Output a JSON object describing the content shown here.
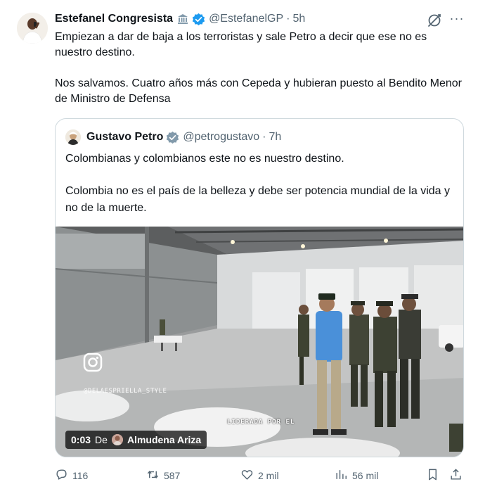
{
  "tweet": {
    "author_name": "Estefanel Congresista",
    "handle": "@EstefanelGP",
    "separator": "·",
    "time": "5h",
    "text_p1": "Empiezan a dar de baja a los terroristas y sale Petro a decir que ese no es nuestro destino.",
    "text_p2": "Nos salvamos. Cuatro años más con Cepeda y hubieran puesto al Bendito Menor de Ministro de Defensa",
    "more_label": "···"
  },
  "quote": {
    "author_name": "Gustavo Petro",
    "handle": "@petrogustavo",
    "separator": "·",
    "time": "7h",
    "text_p1": "Colombianas y colombianos este no es nuestro destino.",
    "text_p2": "Colombia no es el país de la belleza y debe ser potencia mundial de la vida y no de la muerte."
  },
  "video": {
    "watermark": "@DELAESPRIELLA_STYLE",
    "caption": "LIDERADA POR EL",
    "duration": "0:03",
    "from_label": "De",
    "source_author": "Almudena Ariza"
  },
  "actions": {
    "replies": "116",
    "reposts": "587",
    "likes": "2 mil",
    "views": "56 mil"
  },
  "colors": {
    "verified_blue": "#1d9bf0",
    "muted_text": "#536471",
    "border": "#cfd9de",
    "shirt_blue": "#4a90d9"
  },
  "icons": [
    "gov-building-icon",
    "verified-badge-icon",
    "grok-icon",
    "more-icon",
    "instagram-icon",
    "reply-icon",
    "repost-icon",
    "like-icon",
    "views-icon",
    "bookmark-icon",
    "share-icon"
  ]
}
